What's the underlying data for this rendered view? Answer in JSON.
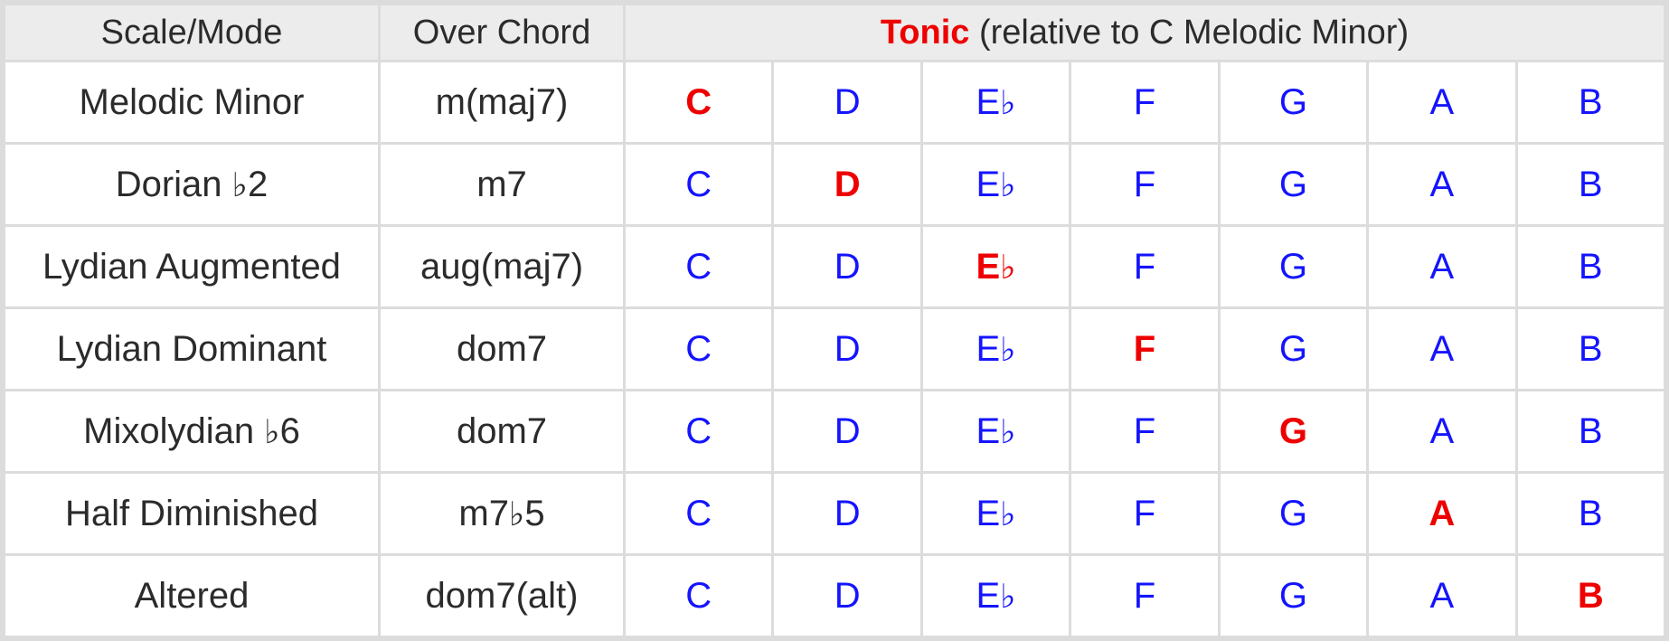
{
  "header": {
    "col_scale": "Scale/Mode",
    "col_chord": "Over Chord",
    "tonic_label": "Tonic",
    "tonic_note": " (relative to C Melodic Minor)",
    "tonic_full": "Tonic (relative to C Melodic Minor)"
  },
  "colors": {
    "highlight": "#ee0000",
    "note": "#1414ff",
    "text": "#2b2b2b",
    "header_bg": "#ececec",
    "cell_bg": "#ffffff",
    "grid": "#dcdcdc"
  },
  "note_columns": [
    "C",
    "D",
    "E♭",
    "F",
    "G",
    "A",
    "B"
  ],
  "rows": [
    {
      "scale": "Melodic Minor",
      "chord": "m(maj7)",
      "tonic_index": 0,
      "notes": [
        "C",
        "D",
        "E♭",
        "F",
        "G",
        "A",
        "B"
      ]
    },
    {
      "scale": "Dorian ♭2",
      "chord": "m7",
      "tonic_index": 1,
      "notes": [
        "C",
        "D",
        "E♭",
        "F",
        "G",
        "A",
        "B"
      ]
    },
    {
      "scale": "Lydian Augmented",
      "chord": "aug(maj7)",
      "tonic_index": 2,
      "notes": [
        "C",
        "D",
        "E♭",
        "F",
        "G",
        "A",
        "B"
      ]
    },
    {
      "scale": "Lydian Dominant",
      "chord": "dom7",
      "tonic_index": 3,
      "notes": [
        "C",
        "D",
        "E♭",
        "F",
        "G",
        "A",
        "B"
      ]
    },
    {
      "scale": "Mixolydian ♭6",
      "chord": "dom7",
      "tonic_index": 4,
      "notes": [
        "C",
        "D",
        "E♭",
        "F",
        "G",
        "A",
        "B"
      ]
    },
    {
      "scale": "Half Diminished",
      "chord": "m7♭5",
      "tonic_index": 5,
      "notes": [
        "C",
        "D",
        "E♭",
        "F",
        "G",
        "A",
        "B"
      ]
    },
    {
      "scale": "Altered",
      "chord": "dom7(alt)",
      "tonic_index": 6,
      "notes": [
        "C",
        "D",
        "E♭",
        "F",
        "G",
        "A",
        "B"
      ]
    }
  ]
}
